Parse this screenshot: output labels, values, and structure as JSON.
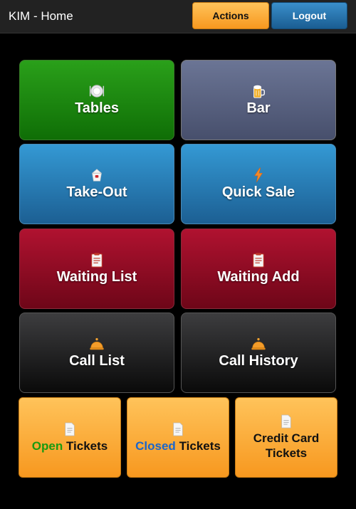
{
  "header": {
    "title": "KIM - Home",
    "actions_label": "Actions",
    "logout_label": "Logout"
  },
  "tiles": [
    {
      "label": "Tables",
      "icon": "plate-icon",
      "color": "#1a8a10"
    },
    {
      "label": "Bar",
      "icon": "beer-mug-icon",
      "color": "#5a6282"
    },
    {
      "label": "Take-Out",
      "icon": "takeout-box-icon",
      "color": "#287dba"
    },
    {
      "label": "Quick Sale",
      "icon": "lightning-icon",
      "color": "#287dba"
    },
    {
      "label": "Waiting List",
      "icon": "clipboard-icon",
      "color": "#8f0c26"
    },
    {
      "label": "Waiting Add",
      "icon": "clipboard-icon",
      "color": "#8f0c26"
    },
    {
      "label": "Call List",
      "icon": "service-bell-icon",
      "color": "#222222"
    },
    {
      "label": "Call History",
      "icon": "service-bell-icon",
      "color": "#222222"
    }
  ],
  "ticket_tiles": [
    {
      "prefix": "Open",
      "suffix": "Tickets",
      "icon": "document-icon"
    },
    {
      "prefix": "Closed",
      "suffix": "Tickets",
      "icon": "document-icon"
    },
    {
      "line1": "Credit Card",
      "line2": "Tickets",
      "icon": "document-icon"
    }
  ],
  "colors": {
    "open_word": "#1a9a10",
    "closed_word": "#1a66cc",
    "orange_button": "#f9a93a",
    "blue_button": "#2272ad"
  }
}
